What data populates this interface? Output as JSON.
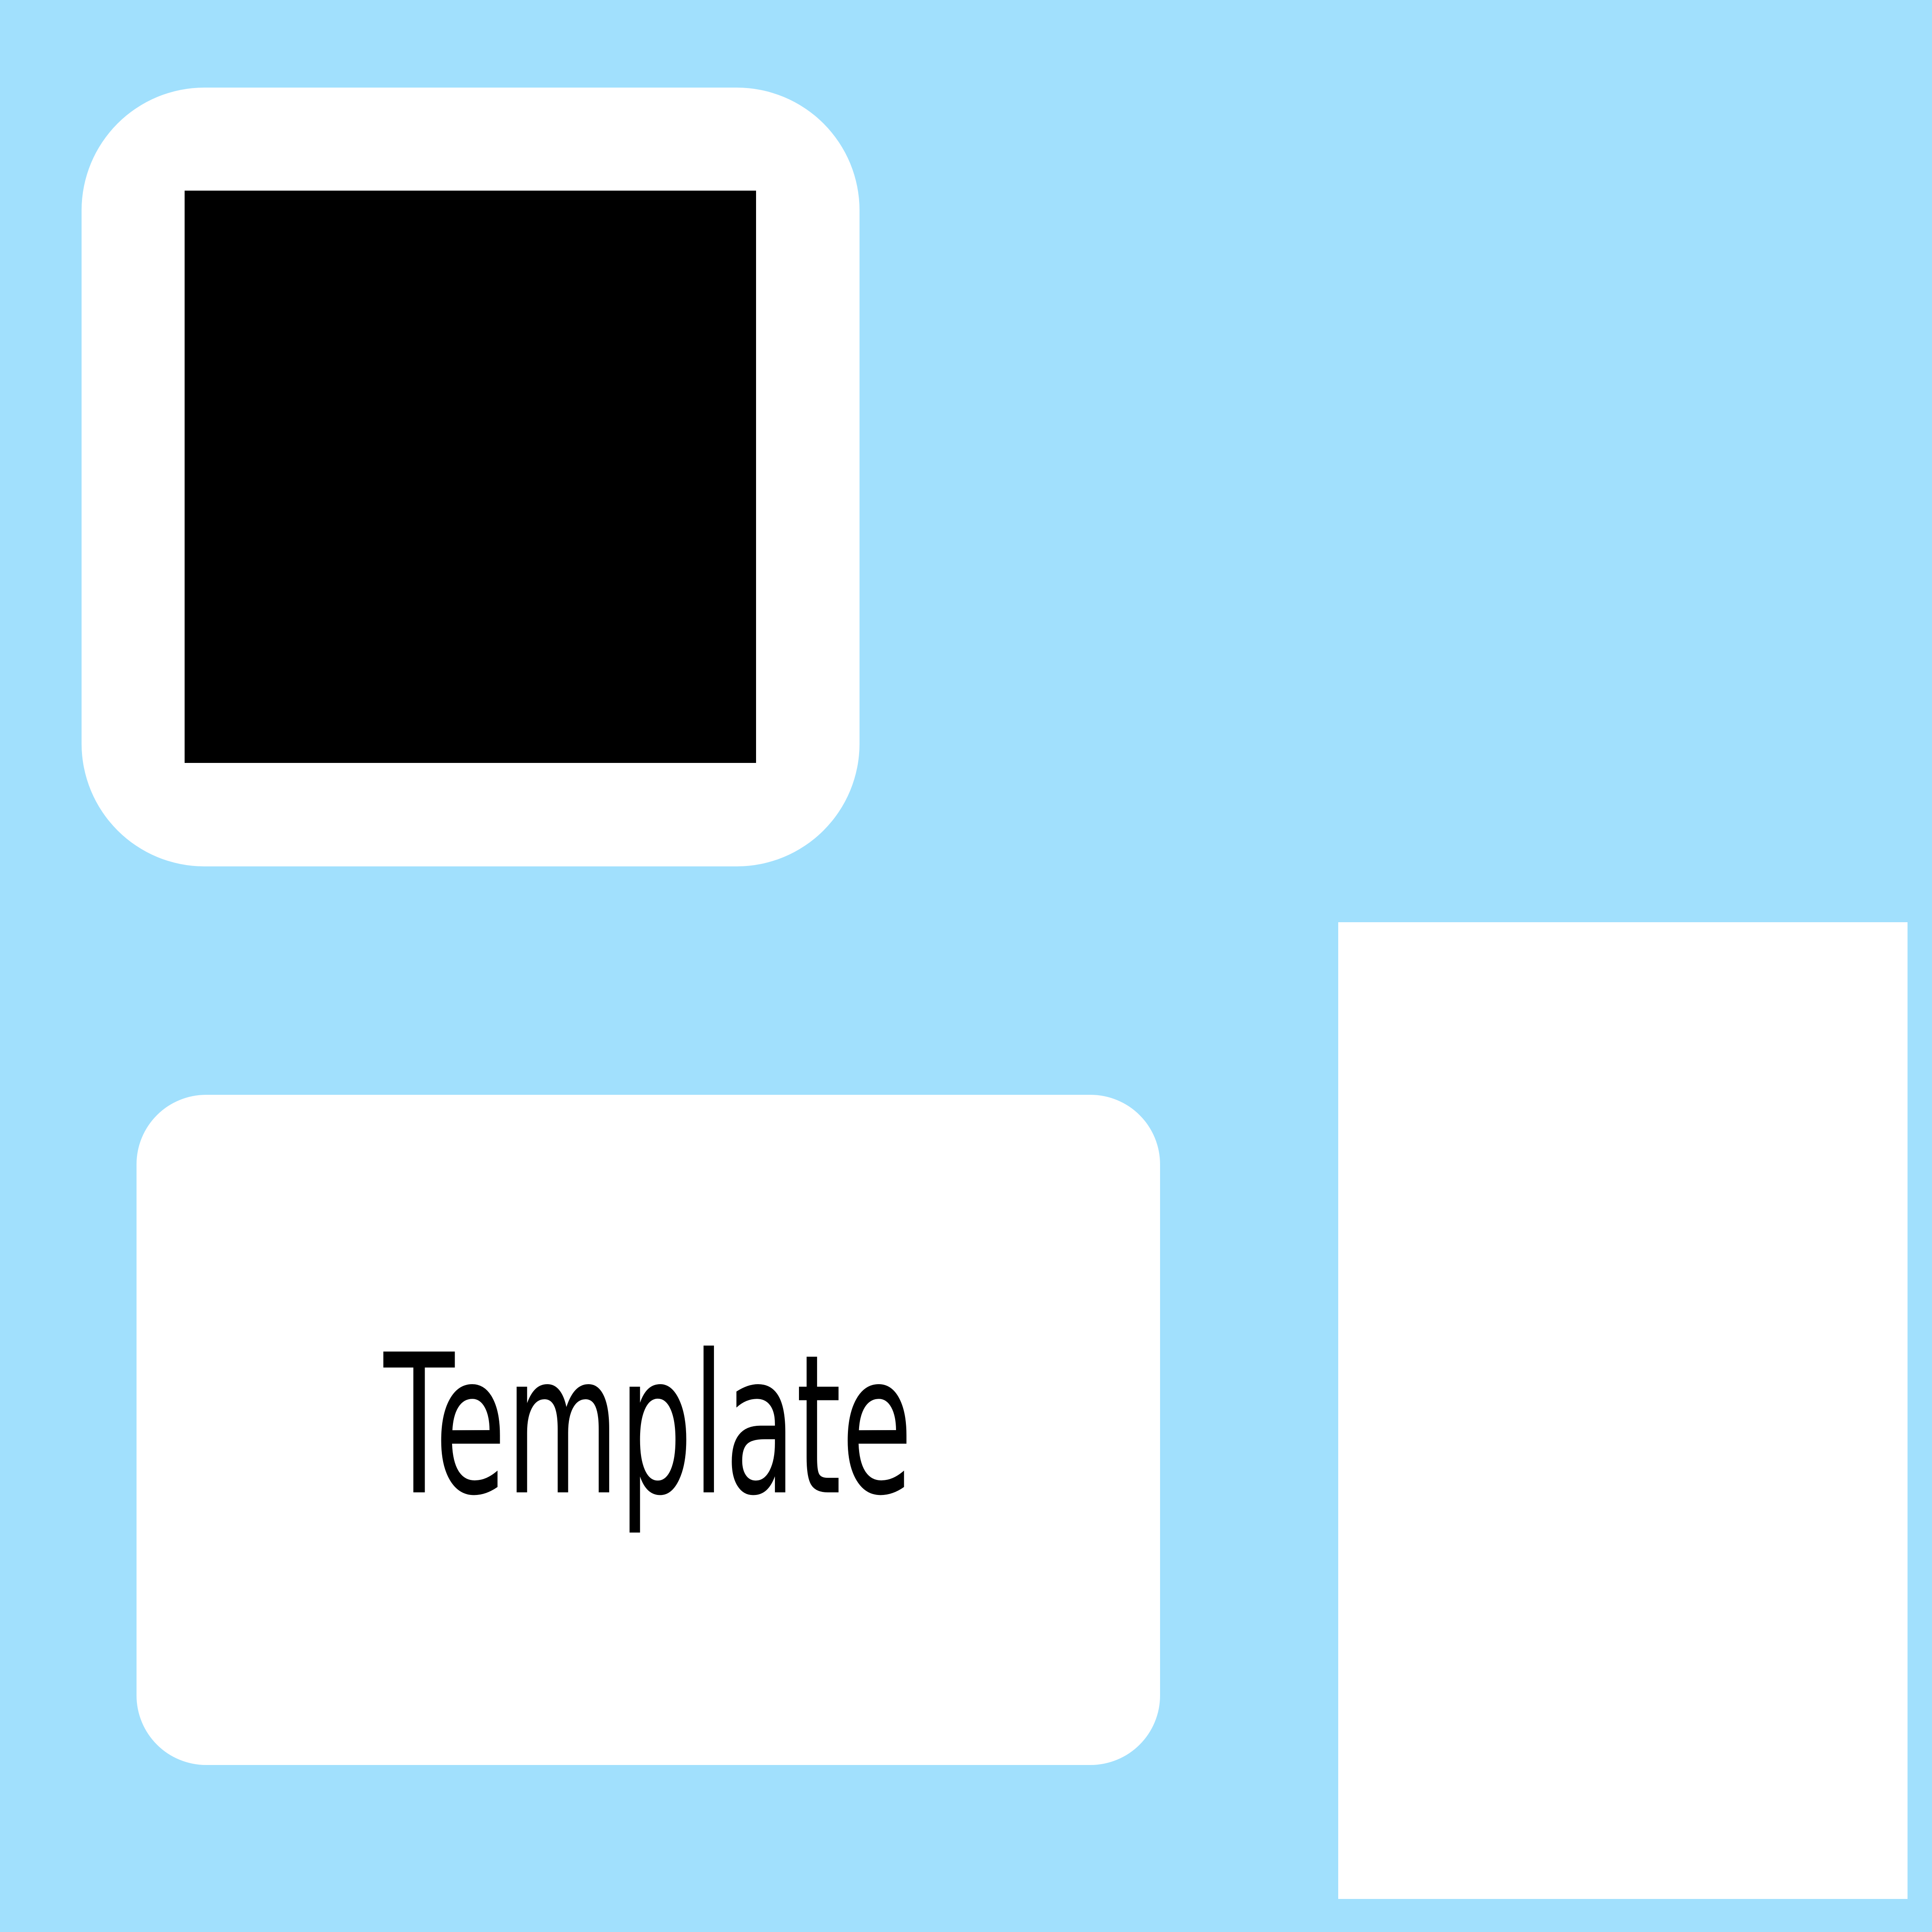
{
  "canvas": {
    "background_color": "#a1e0fd"
  },
  "image_card": {
    "background_color": "#ffffff",
    "placeholder_color": "#000000"
  },
  "template_card": {
    "background_color": "#ffffff",
    "label": "Template",
    "label_color": "#000000"
  },
  "side_panel": {
    "background_color": "#ffffff"
  }
}
